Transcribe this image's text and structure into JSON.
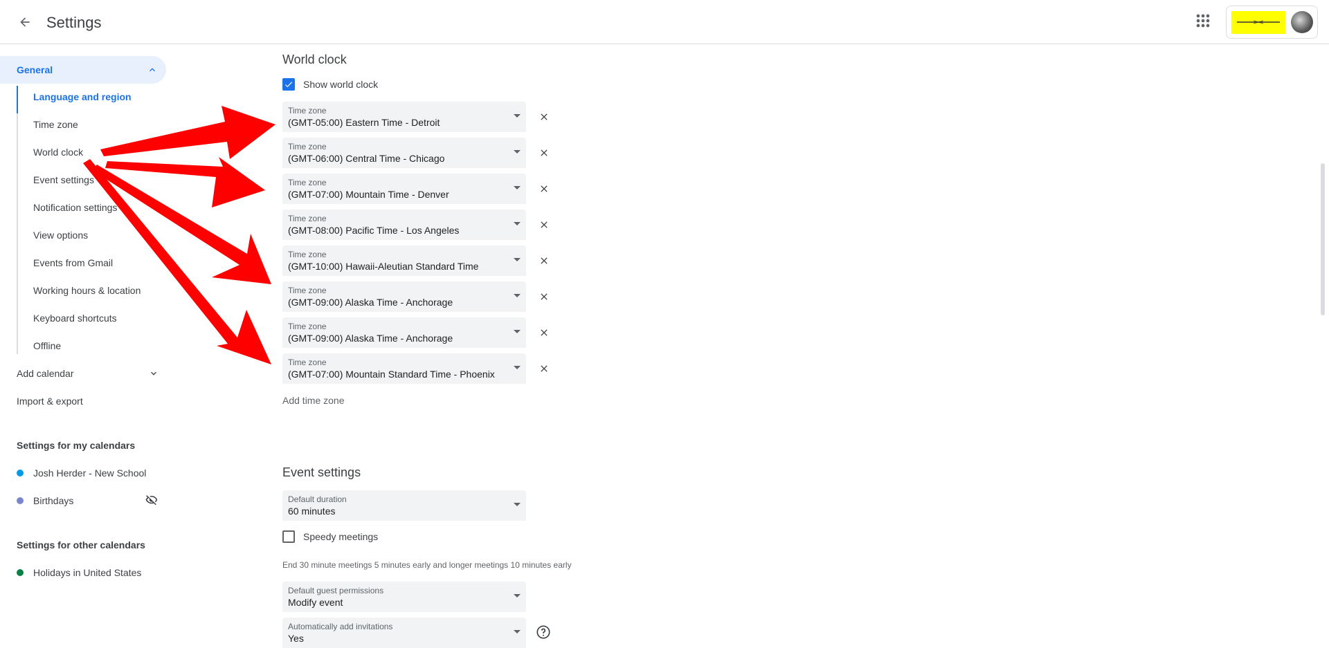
{
  "header": {
    "title": "Settings",
    "back_icon": "arrow-back-icon",
    "apps_icon": "apps-grid-icon"
  },
  "sidebar": {
    "general_label": "General",
    "general_items": [
      {
        "label": "Language and region",
        "active": true
      },
      {
        "label": "Time zone"
      },
      {
        "label": "World clock"
      },
      {
        "label": "Event settings"
      },
      {
        "label": "Notification settings"
      },
      {
        "label": "View options"
      },
      {
        "label": "Events from Gmail"
      },
      {
        "label": "Working hours & location"
      },
      {
        "label": "Keyboard shortcuts"
      },
      {
        "label": "Offline"
      }
    ],
    "add_calendar": "Add calendar",
    "import_export": "Import & export",
    "my_calendars_heading": "Settings for my calendars",
    "my_calendars": [
      {
        "label": "Josh Herder - New School",
        "color": "#039be5"
      },
      {
        "label": "Birthdays",
        "color": "#7986cb",
        "hidden": true
      }
    ],
    "other_calendars_heading": "Settings for other calendars",
    "other_calendars": [
      {
        "label": "Holidays in United States",
        "color": "#0b8043"
      }
    ]
  },
  "world_clock": {
    "title": "World clock",
    "show_label": "Show world clock",
    "show_checked": true,
    "field_label": "Time zone",
    "zones": [
      "(GMT-05:00) Eastern Time - Detroit",
      "(GMT-06:00) Central Time - Chicago",
      "(GMT-07:00) Mountain Time - Denver",
      "(GMT-08:00) Pacific Time - Los Angeles",
      "(GMT-10:00) Hawaii-Aleutian Standard Time",
      "(GMT-09:00) Alaska Time - Anchorage",
      "(GMT-09:00) Alaska Time - Anchorage",
      "(GMT-07:00) Mountain Standard Time - Phoenix"
    ],
    "add_label": "Add time zone"
  },
  "event_settings": {
    "title": "Event settings",
    "duration_label": "Default duration",
    "duration_value": "60 minutes",
    "speedy_label": "Speedy meetings",
    "speedy_checked": false,
    "speedy_hint": "End 30 minute meetings 5 minutes early and longer meetings 10 minutes early",
    "guest_label": "Default guest permissions",
    "guest_value": "Modify event",
    "invites_label": "Automatically add invitations",
    "invites_value": "Yes"
  },
  "colors": {
    "accent": "#1a73e8",
    "annotation_arrow": "#ff0000",
    "brand_highlight": "#ffff00"
  }
}
